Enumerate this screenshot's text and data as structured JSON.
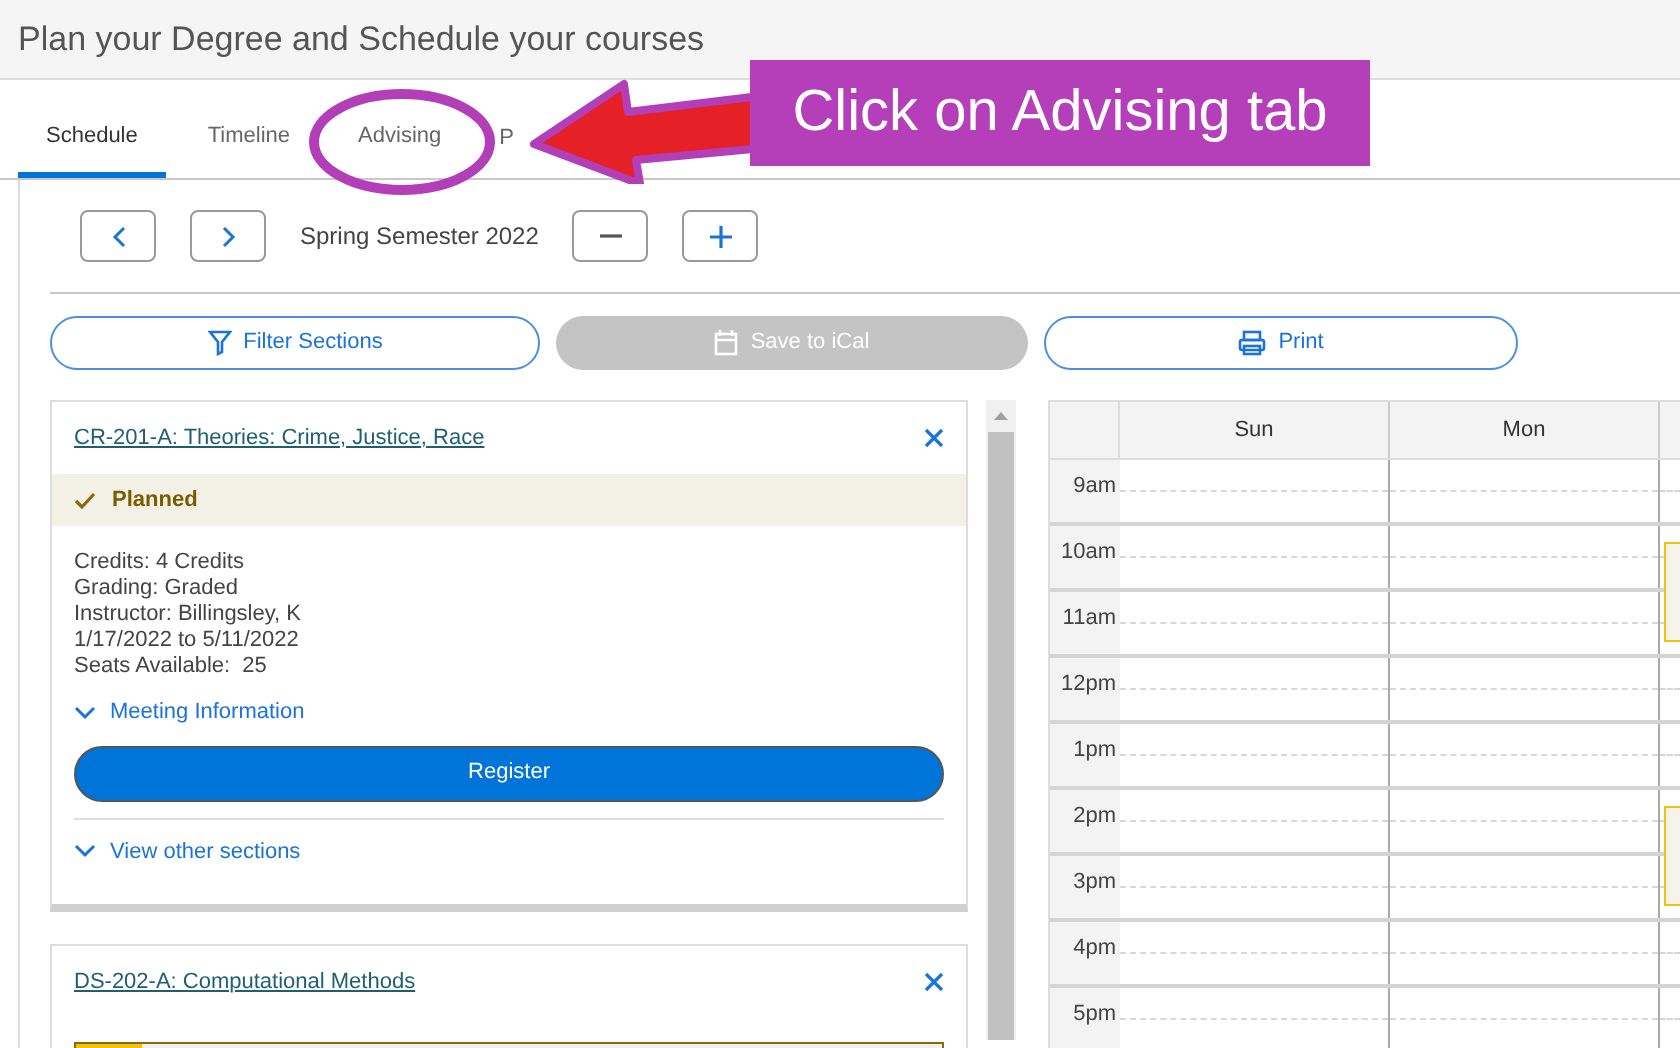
{
  "page_title": "Plan your Degree and Schedule your courses",
  "tabs": [
    {
      "label": "Schedule",
      "selected": true
    },
    {
      "label": "Timeline",
      "selected": false
    },
    {
      "label": "Advising",
      "selected": false
    },
    {
      "label": "P",
      "selected": false
    }
  ],
  "term": {
    "label": "Spring Semester 2022"
  },
  "actions": [
    {
      "label": "Filter Sections",
      "kind": "filter",
      "disabled": false
    },
    {
      "label": "Save to iCal",
      "kind": "calendar",
      "disabled": true
    },
    {
      "label": "Print",
      "kind": "print",
      "disabled": false
    }
  ],
  "courses": [
    {
      "title": "CR-201-A: Theories: Crime, Justice, Race",
      "status": {
        "kind": "planned",
        "label": "Planned"
      },
      "details": [
        "Credits: 4 Credits",
        "Grading: Graded",
        "Instructor: Billingsley, K",
        "1/17/2022 to 5/11/2022",
        "Seats Available:  25"
      ],
      "meeting_link": "Meeting Information",
      "register_button": "Register",
      "other_sections_link": "View other sections"
    },
    {
      "title": "DS-202-A: Computational Methods",
      "status": {
        "kind": "pending"
      }
    }
  ],
  "calendar": {
    "days": [
      "Sun",
      "Mon"
    ],
    "hours": [
      {
        "label": "9am",
        "column_3_event": false
      },
      {
        "label": "10am",
        "column_3_event": true
      },
      {
        "label": "11am",
        "column_3_event": false
      },
      {
        "label": "12pm",
        "column_3_event": false
      },
      {
        "label": "1pm",
        "column_3_event": false
      },
      {
        "label": "2pm",
        "column_3_event": true
      },
      {
        "label": "3pm",
        "column_3_event": false
      },
      {
        "label": "4pm",
        "column_3_event": false
      },
      {
        "label": "5pm",
        "column_3_event": false
      }
    ]
  },
  "annotation": {
    "callout": "Click on Advising tab"
  }
}
